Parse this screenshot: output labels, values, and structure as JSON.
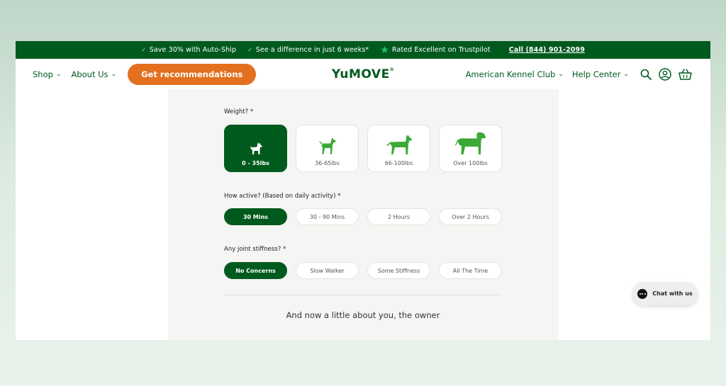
{
  "promo_bar": {
    "item1": "Save 30% with Auto-Ship",
    "item2": "See a difference in just 6 weeks*",
    "item3": "Rated Excellent on Trustpilot",
    "phone": "Call (844) 901-2099"
  },
  "nav": {
    "shop": "Shop",
    "about": "About Us",
    "cta": "Get recommendations",
    "logo": "YuMOVE",
    "akc": "American Kennel Club",
    "help": "Help Center"
  },
  "quiz": {
    "weight_label": "Weight? *",
    "weight_options": [
      "0 - 35lbs",
      "36-65lbs",
      "66-100lbs",
      "Over 100lbs"
    ],
    "activity_label": "How active? (Based on daily activity) *",
    "activity_options": [
      "30 Mins",
      "30 - 90 Mins",
      "2 Hours",
      "Over 2 Hours"
    ],
    "stiffness_label": "Any joint stiffness? *",
    "stiffness_options": [
      "No Concerns",
      "Slow Walker",
      "Some Stiffness",
      "All The Time"
    ],
    "owner_heading": "And now a little about you, the owner"
  },
  "chat": {
    "label": "Chat with us"
  },
  "colors": {
    "brand_green": "#005a1e",
    "accent_orange": "#e2701f",
    "dog_green": "#3aa935"
  }
}
